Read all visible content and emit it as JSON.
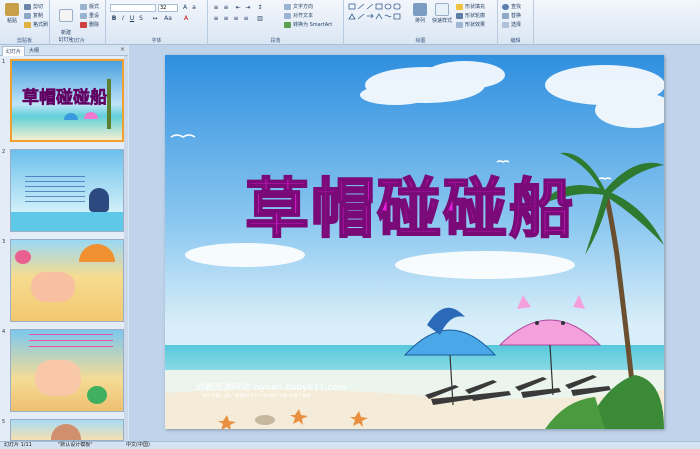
{
  "ribbon": {
    "clipboard": {
      "paste": "粘贴",
      "cut": "剪切",
      "copy": "复制",
      "format": "格式刷",
      "label": "剪贴板"
    },
    "slides": {
      "new_slide": "新建\n幻灯片",
      "layout": "版式",
      "reset": "重设",
      "delete": "删除",
      "label": "幻灯片"
    },
    "font": {
      "size": "32",
      "label": "字体"
    },
    "paragraph": {
      "text_direction": "文字方向",
      "align_text": "对齐文本",
      "smartart": "转换为 SmartArt",
      "label": "段落"
    },
    "drawing": {
      "arrange": "排列",
      "quick_styles": "快速样式",
      "shape_fill": "形状填充",
      "shape_outline": "形状轮廓",
      "shape_effects": "形状效果",
      "label": "绘图"
    },
    "editing": {
      "find": "查找",
      "replace": "替换",
      "select": "选择",
      "label": "编辑"
    }
  },
  "panel": {
    "tab_slides": "幻灯片",
    "tab_outline": "大纲"
  },
  "thumbnails": [
    "1",
    "2",
    "3",
    "4",
    "5"
  ],
  "slide": {
    "title": "草帽碰碰船",
    "site": "幼教资源网站  ziyuan.baby611.com",
    "sub": "课件下载   儿歌、故事MP3   FLASH课件下载   试卷下载等"
  },
  "status": {
    "slide_count": "幻灯片 1/11",
    "theme": "\"默认设计模板\"",
    "language": "中文(中国)"
  },
  "colors": {
    "title_fill": "#e81ee0",
    "title_outline": "#7a0a78",
    "sea": "#45c4d8",
    "sky": "#2f8fe0",
    "selected_thumb": "#f0a030"
  }
}
